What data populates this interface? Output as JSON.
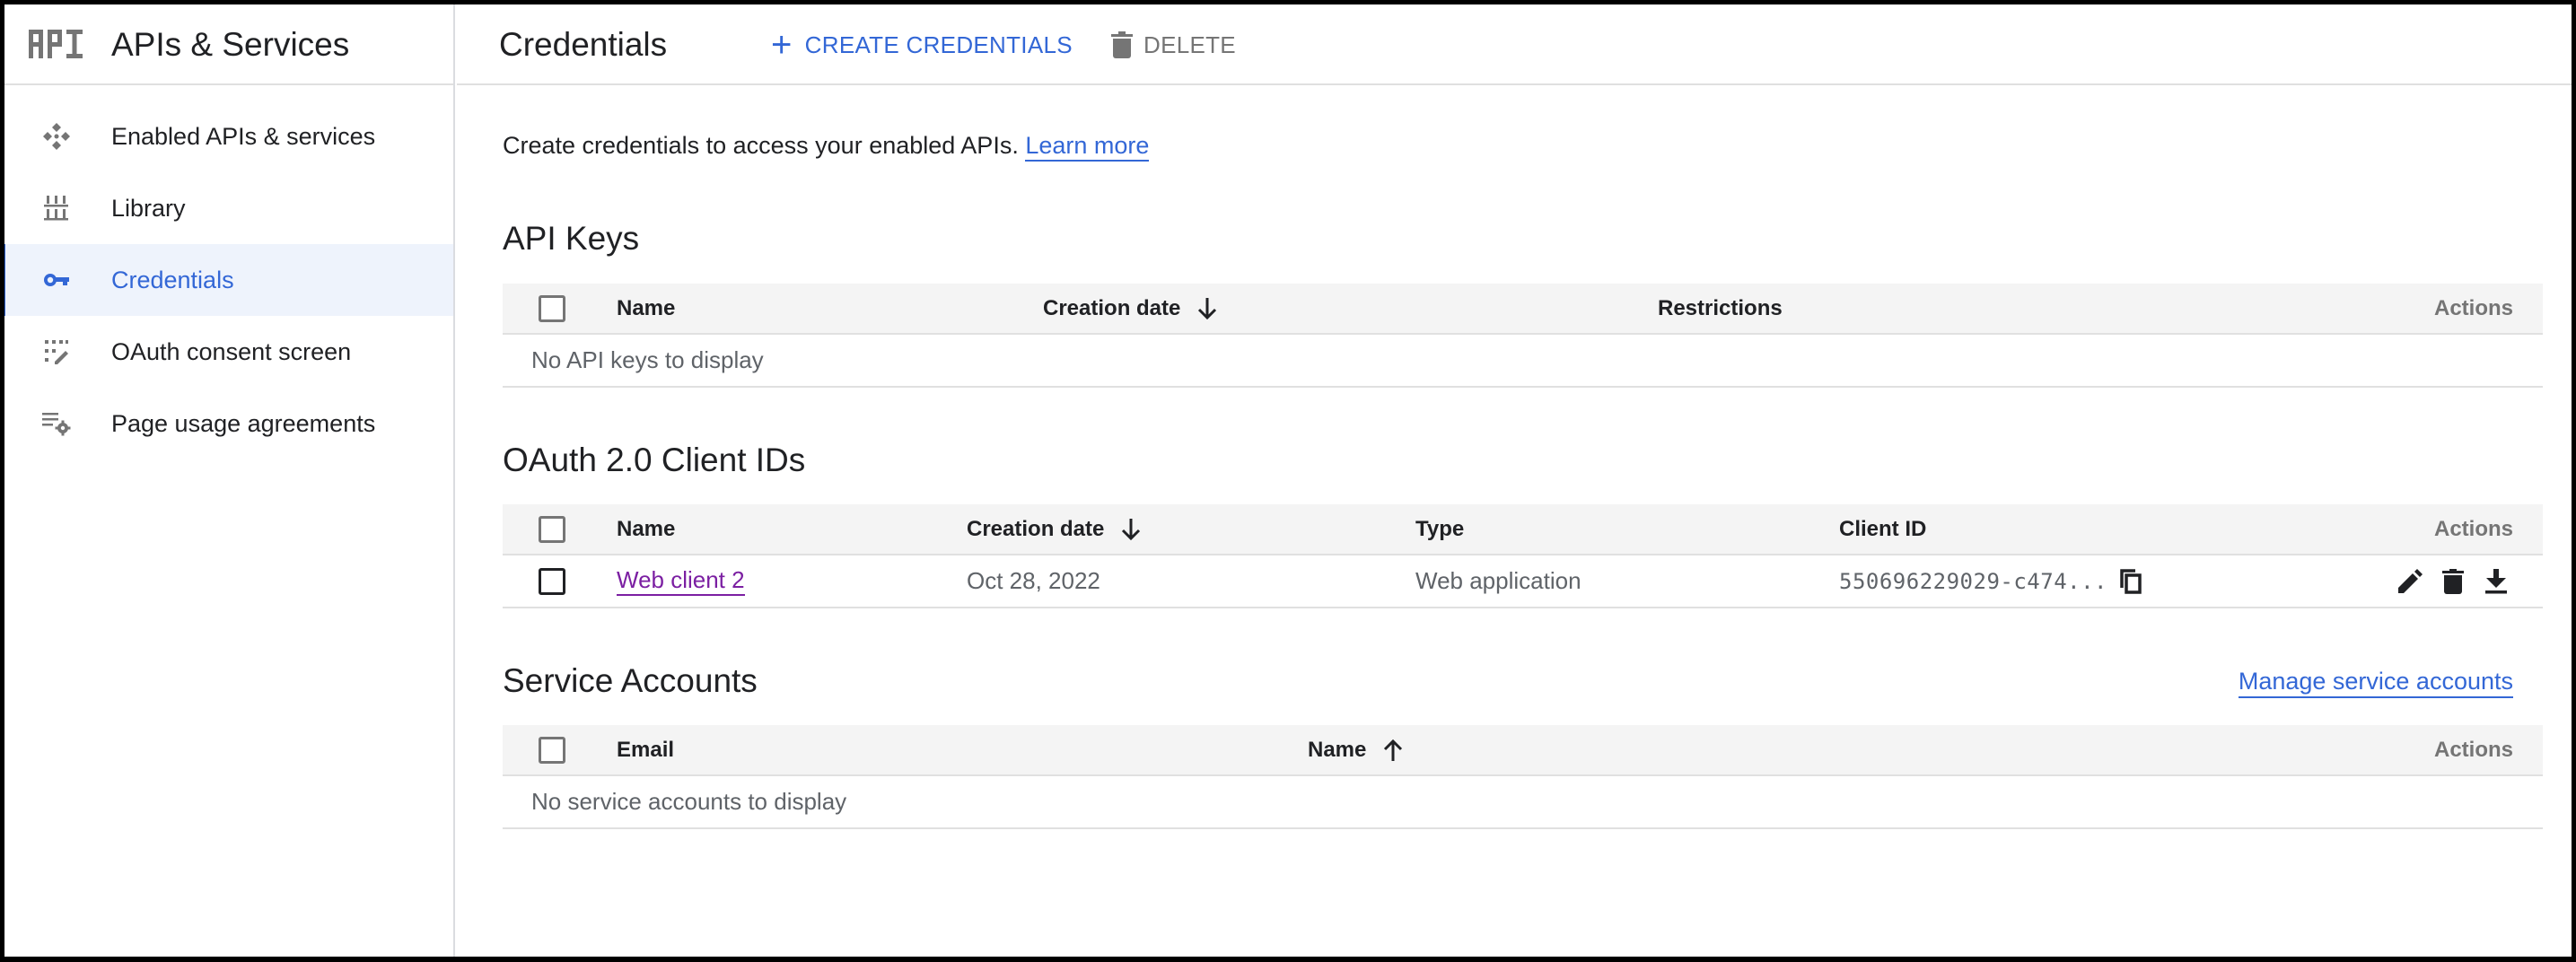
{
  "sidebar": {
    "logo_text": "API",
    "title": "APIs & Services",
    "items": [
      {
        "label": "Enabled APIs & services",
        "icon": "enabled-apis-icon",
        "active": false
      },
      {
        "label": "Library",
        "icon": "library-icon",
        "active": false
      },
      {
        "label": "Credentials",
        "icon": "key-icon",
        "active": true
      },
      {
        "label": "OAuth consent screen",
        "icon": "oauth-consent-icon",
        "active": false
      },
      {
        "label": "Page usage agreements",
        "icon": "settings-list-icon",
        "active": false
      }
    ]
  },
  "header": {
    "title": "Credentials",
    "create_label": "CREATE CREDENTIALS",
    "create_icon": "plus-icon",
    "delete_label": "DELETE",
    "delete_icon": "trash-icon"
  },
  "intro": {
    "text": "Create credentials to access your enabled APIs.",
    "link": "Learn more"
  },
  "api_keys": {
    "title": "API Keys",
    "columns": [
      "Name",
      "Creation date",
      "Restrictions",
      "Actions"
    ],
    "sort": {
      "column": "Creation date",
      "direction": "descending"
    },
    "empty_message": "No API keys to display",
    "rows": []
  },
  "oauth_clients": {
    "title": "OAuth 2.0 Client IDs",
    "columns": [
      "Name",
      "Creation date",
      "Type",
      "Client ID",
      "Actions"
    ],
    "sort": {
      "column": "Creation date",
      "direction": "descending"
    },
    "rows": [
      {
        "name": "Web client 2",
        "creation_date": "Oct 28, 2022",
        "type": "Web application",
        "client_id": "550696229029-c474...",
        "actions": [
          "edit-icon",
          "delete-icon",
          "download-icon"
        ]
      }
    ]
  },
  "service_accounts": {
    "title": "Service Accounts",
    "manage_link": "Manage service accounts",
    "columns": [
      "Email",
      "Name",
      "Actions"
    ],
    "sort": {
      "column": "Name",
      "direction": "ascending"
    },
    "empty_message": "No service accounts to display",
    "rows": []
  },
  "colors": {
    "accent": "#3367d6",
    "visited_link": "#7b1fa2",
    "active_nav_bg": "#eef3fc",
    "table_header_bg": "#f4f4f4"
  }
}
